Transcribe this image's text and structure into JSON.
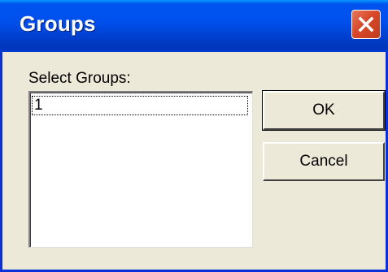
{
  "window": {
    "title": "Groups"
  },
  "dialog": {
    "select_label": "Select Groups:",
    "groups": [
      "1"
    ],
    "ok_label": "OK",
    "cancel_label": "Cancel"
  },
  "colors": {
    "titlebar_blue": "#0053ee",
    "close_red": "#d8482a",
    "dialog_bg": "#ece9d8"
  },
  "icons": {
    "close": "close-icon"
  }
}
